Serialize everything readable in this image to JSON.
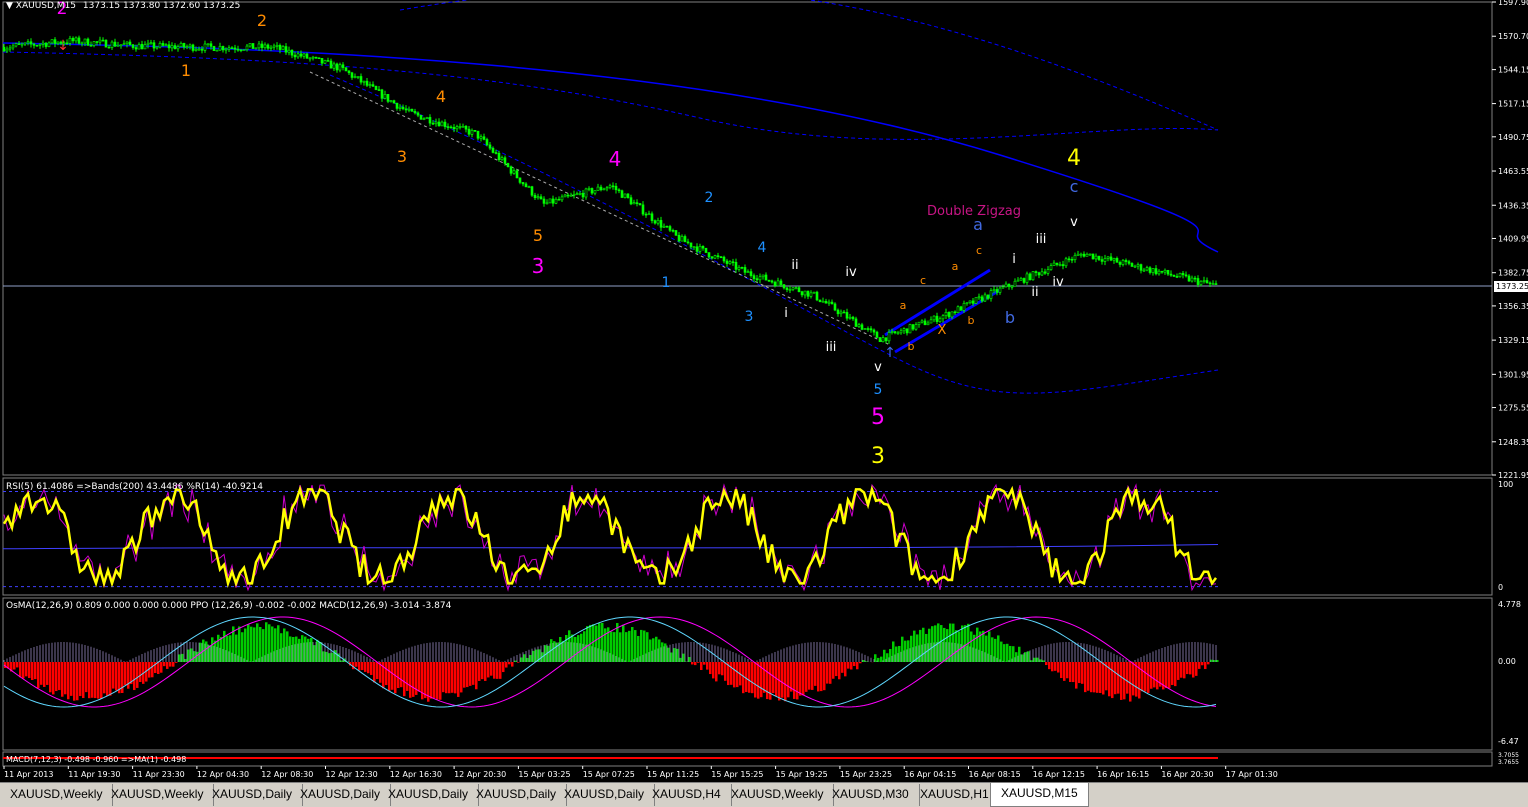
{
  "title": "XAUUSD,M15",
  "ohlc": "1373.15 1373.80 1372.60 1373.25",
  "last_price": "1373.25",
  "colors": {
    "bull": "#00ff00",
    "rsi": "#ffff00",
    "osma_up": "#00cc00",
    "osma_down": "#ff0000",
    "macd": "#5fd7ff",
    "signal": "#ff00ff",
    "channel": "#0000ff",
    "grid": "#ffffff"
  },
  "price_axis": [
    "1597.90",
    "1570.70",
    "1544.15",
    "1517.15",
    "1490.75",
    "1463.55",
    "1436.35",
    "1409.95",
    "1382.75",
    "1356.35",
    "1329.15",
    "1301.95",
    "1275.55",
    "1248.35",
    "1221.95"
  ],
  "time_axis": [
    "11 Apr 2013",
    "11 Apr 19:30",
    "11 Apr 23:30",
    "12 Apr 04:30",
    "12 Apr 08:30",
    "12 Apr 12:30",
    "12 Apr 16:30",
    "12 Apr 20:30",
    "15 Apr 03:25",
    "15 Apr 07:25",
    "15 Apr 11:25",
    "15 Apr 15:25",
    "15 Apr 19:25",
    "15 Apr 23:25",
    "16 Apr 04:15",
    "16 Apr 08:15",
    "16 Apr 12:15",
    "16 Apr 16:15",
    "16 Apr 20:30",
    "17 Apr 01:30"
  ],
  "waves": [
    {
      "t": "2",
      "c": "#ff00ff",
      "x": 62,
      "y": 14,
      "s": 17
    },
    {
      "t": "2",
      "c": "#ff8c00",
      "x": 262,
      "y": 26,
      "s": 16
    },
    {
      "t": "1",
      "c": "#ff8c00",
      "x": 186,
      "y": 76,
      "s": 16
    },
    {
      "t": "4",
      "c": "#ff8c00",
      "x": 441,
      "y": 102,
      "s": 16
    },
    {
      "t": "3",
      "c": "#ff8c00",
      "x": 402,
      "y": 162,
      "s": 16
    },
    {
      "t": "4",
      "c": "#ff00ff",
      "x": 615,
      "y": 166,
      "s": 20
    },
    {
      "t": "5",
      "c": "#ff8c00",
      "x": 538,
      "y": 241,
      "s": 16
    },
    {
      "t": "3",
      "c": "#ff00ff",
      "x": 538,
      "y": 273,
      "s": 20
    },
    {
      "t": "2",
      "c": "#1e90ff",
      "x": 709,
      "y": 202,
      "s": 14
    },
    {
      "t": "4",
      "c": "#1e90ff",
      "x": 762,
      "y": 252,
      "s": 14
    },
    {
      "t": "1",
      "c": "#1e90ff",
      "x": 666,
      "y": 287,
      "s": 14
    },
    {
      "t": "3",
      "c": "#1e90ff",
      "x": 749,
      "y": 321,
      "s": 14
    },
    {
      "t": "ii",
      "c": "#ffffff",
      "x": 795,
      "y": 269,
      "s": 13
    },
    {
      "t": "iv",
      "c": "#ffffff",
      "x": 851,
      "y": 276,
      "s": 13
    },
    {
      "t": "i",
      "c": "#ffffff",
      "x": 786,
      "y": 317,
      "s": 13
    },
    {
      "t": "iii",
      "c": "#ffffff",
      "x": 831,
      "y": 351,
      "s": 13
    },
    {
      "t": "v",
      "c": "#ffffff",
      "x": 878,
      "y": 371,
      "s": 13
    },
    {
      "t": "5",
      "c": "#1e90ff",
      "x": 878,
      "y": 394,
      "s": 14
    },
    {
      "t": "5",
      "c": "#ff00ff",
      "x": 878,
      "y": 424,
      "s": 22
    },
    {
      "t": "3",
      "c": "#ffff00",
      "x": 878,
      "y": 463,
      "s": 22
    },
    {
      "t": "Double Zigzag",
      "c": "#c71585",
      "x": 974,
      "y": 215,
      "s": 13
    },
    {
      "t": "a",
      "c": "#4169e1",
      "x": 978,
      "y": 230,
      "s": 16
    },
    {
      "t": "c",
      "c": "#ff8c00",
      "x": 979,
      "y": 254,
      "s": 11
    },
    {
      "t": "a",
      "c": "#ff8c00",
      "x": 955,
      "y": 270,
      "s": 11
    },
    {
      "t": "c",
      "c": "#ff8c00",
      "x": 923,
      "y": 284,
      "s": 11
    },
    {
      "t": "a",
      "c": "#ff8c00",
      "x": 903,
      "y": 309,
      "s": 11
    },
    {
      "t": "b",
      "c": "#ff8c00",
      "x": 911,
      "y": 350,
      "s": 11
    },
    {
      "t": "b",
      "c": "#ff8c00",
      "x": 971,
      "y": 324,
      "s": 11
    },
    {
      "t": "X",
      "c": "#ff8c00",
      "x": 942,
      "y": 334,
      "s": 13
    },
    {
      "t": "b",
      "c": "#4169e1",
      "x": 1010,
      "y": 323,
      "s": 16
    },
    {
      "t": "i",
      "c": "#ffffff",
      "x": 1014,
      "y": 263,
      "s": 13
    },
    {
      "t": "iii",
      "c": "#ffffff",
      "x": 1041,
      "y": 243,
      "s": 13
    },
    {
      "t": "v",
      "c": "#ffffff",
      "x": 1074,
      "y": 226,
      "s": 13
    },
    {
      "t": "ii",
      "c": "#ffffff",
      "x": 1035,
      "y": 296,
      "s": 13
    },
    {
      "t": "iv",
      "c": "#ffffff",
      "x": 1058,
      "y": 286,
      "s": 13
    },
    {
      "t": "4",
      "c": "#ffff00",
      "x": 1074,
      "y": 165,
      "s": 22
    },
    {
      "t": "c",
      "c": "#4169e1",
      "x": 1074,
      "y": 192,
      "s": 16
    }
  ],
  "rsi": {
    "label": "RSI(5) 61.4086  =>Bands(200) 43.4486  %R(14) -40.9214",
    "axis": [
      "100",
      "0"
    ]
  },
  "osma": {
    "label": "OsMA(12,26,9) 0.809 0.000 0.000 0.000   PPO (12,26,9) -0.002 -0.002   MACD(12,26,9) -3.014 -3.874",
    "axis": [
      "4.778",
      "0.00",
      "-6.47"
    ]
  },
  "macd2": {
    "label": "MACD(7,12,3) -0.498 -0.960  =>MA(1) -0.498",
    "axis": [
      "3.7055",
      "3.7655"
    ]
  },
  "chart_data": {
    "type": "line",
    "title": "XAUUSD,M15",
    "x": [
      "11 Apr 2013",
      "11 Apr 19:30",
      "11 Apr 23:30",
      "12 Apr 04:30",
      "12 Apr 08:30",
      "12 Apr 12:30",
      "12 Apr 16:30",
      "12 Apr 20:30",
      "15 Apr 03:25",
      "15 Apr 07:25",
      "15 Apr 11:25",
      "15 Apr 15:25",
      "15 Apr 19:25",
      "15 Apr 23:25",
      "16 Apr 04:15",
      "16 Apr 08:15",
      "16 Apr 12:15",
      "16 Apr 16:15",
      "16 Apr 20:30"
    ],
    "series": [
      {
        "values": [
          1562,
          1567,
          1563,
          1562,
          1562,
          1545,
          1510,
          1493,
          1437,
          1452,
          1410,
          1383,
          1365,
          1330,
          1350,
          1375,
          1398,
          1385,
          1372
        ]
      }
    ],
    "ylim": [
      1221.95,
      1597.9
    ],
    "grid": false
  }
}
